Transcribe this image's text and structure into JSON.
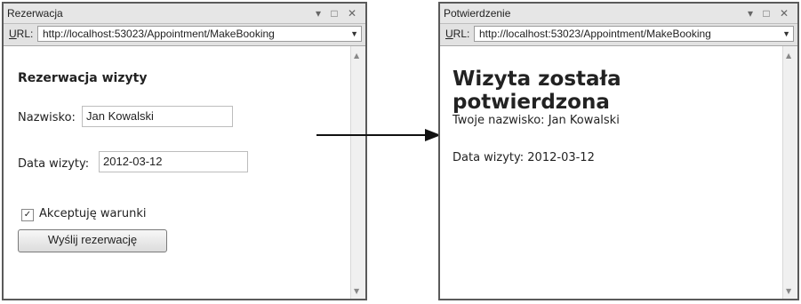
{
  "left_window": {
    "title": "Rezerwacja",
    "url_label_accel": "U",
    "url_label_rest": "RL:",
    "url": "http://localhost:53023/Appointment/MakeBooking",
    "heading": "Rezerwacja wizyty",
    "name_label": "Nazwisko:",
    "name_value": "Jan Kowalski",
    "date_label": "Data wizyty:",
    "date_value": "2012-03-12",
    "terms_label": "Akceptuję warunki",
    "terms_checked": true,
    "submit_label": "Wyślij rezerwację"
  },
  "right_window": {
    "title": "Potwierdzenie",
    "url_label_accel": "U",
    "url_label_rest": "RL:",
    "url": "http://localhost:53023/Appointment/MakeBooking",
    "heading": "Wizyta została potwierdzona",
    "name_line": "Twoje nazwisko: Jan Kowalski",
    "date_line": "Data wizyty: 2012-03-12"
  },
  "window_controls": "▾ □ ✕",
  "colors": {
    "window_border": "#5a5a5a",
    "titlebar": "#e6e6e6",
    "arrow": "#111111"
  }
}
